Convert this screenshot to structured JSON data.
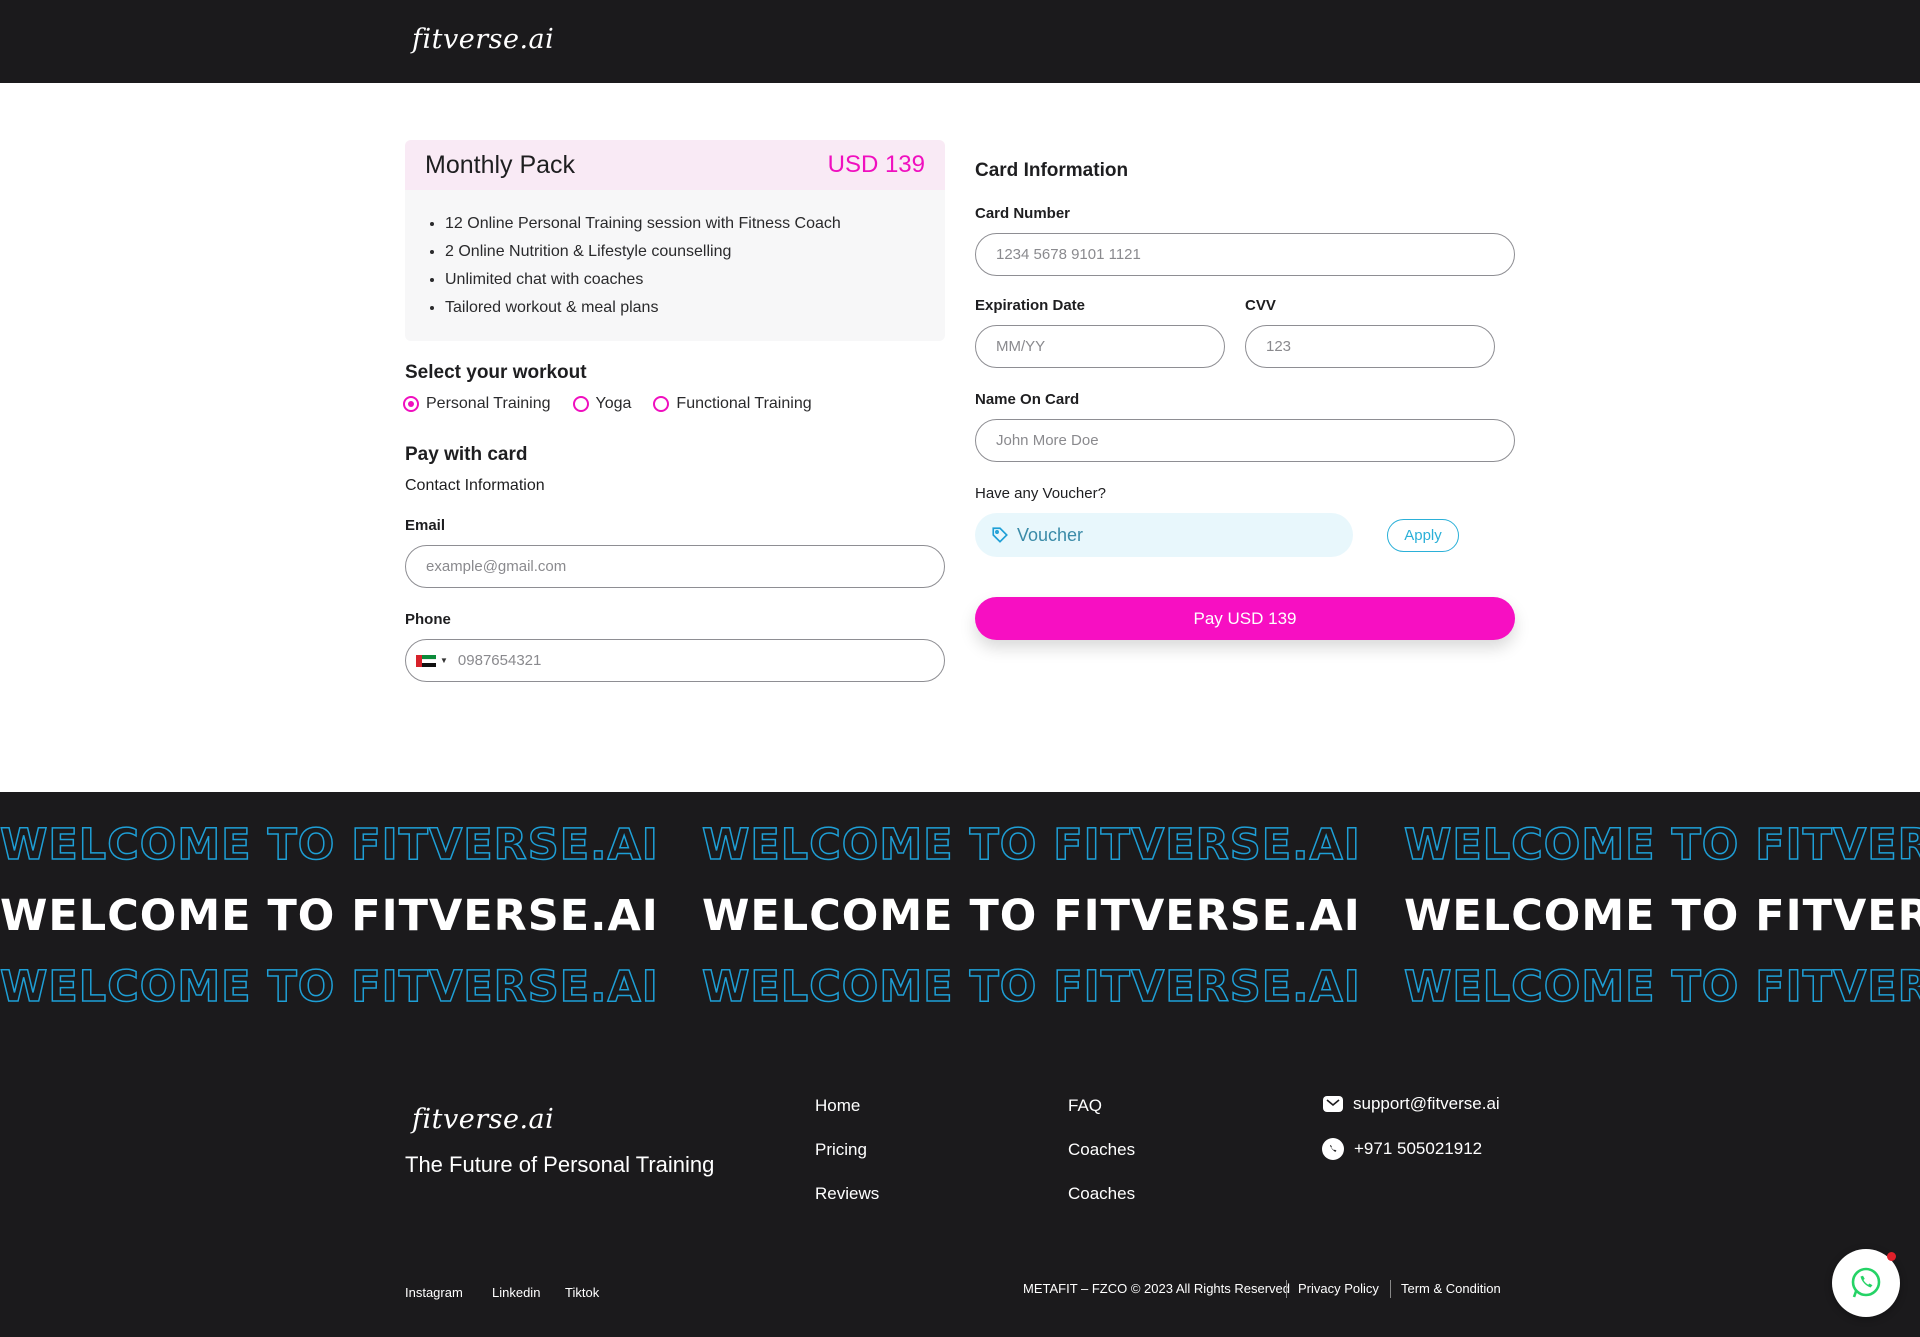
{
  "brand": {
    "logo_text": "fitverse.ai"
  },
  "pack": {
    "title": "Monthly Pack",
    "price": "USD 139",
    "features": [
      "12 Online Personal Training session with Fitness Coach",
      "2 Online Nutrition & Lifestyle counselling",
      "Unlimited chat with coaches",
      "Tailored workout & meal plans"
    ]
  },
  "workout": {
    "title": "Select your workout",
    "options": [
      "Personal Training",
      "Yoga",
      "Functional Training"
    ],
    "selected": "Personal Training"
  },
  "pay_with_card": {
    "title": "Pay with card",
    "subtitle": "Contact Information",
    "email_label": "Email",
    "email_placeholder": "example@gmail.com",
    "phone_label": "Phone",
    "phone_placeholder": "0987654321"
  },
  "card_info": {
    "title": "Card Information",
    "card_number_label": "Card Number",
    "card_number_placeholder": "1234 5678 9101 1121",
    "expiry_label": "Expiration Date",
    "expiry_placeholder": "MM/YY",
    "cvv_label": "CVV",
    "cvv_placeholder": "123",
    "name_label": "Name On Card",
    "name_placeholder": "John More Doe",
    "voucher_label": "Have any Voucher?",
    "voucher_placeholder": "Voucher",
    "apply_label": "Apply",
    "pay_label": "Pay USD 139"
  },
  "marquee": {
    "text": "WELCOME TO FITVERSE.AI"
  },
  "footer": {
    "logo_text": "fitverse.ai",
    "tagline": "The Future of Personal Training",
    "links_col1": [
      "Home",
      "Pricing",
      "Reviews"
    ],
    "links_col2": [
      "FAQ",
      "Coaches",
      "Coaches"
    ],
    "email": "support@fitverse.ai",
    "phone": "+971 505021912",
    "social": [
      "Instagram",
      "Linkedin",
      "Tiktok"
    ],
    "copyright": "METAFIT – FZCO © 2023 All Rights Reserved",
    "privacy": "Privacy Policy",
    "terms": "Term & Condition"
  },
  "colors": {
    "accent": "#f70fc2",
    "outline": "#1e9fd6",
    "dark": "#1b1a1c"
  },
  "icons": {
    "voucher": "tag-icon",
    "email": "mail-icon",
    "phone": "whatsapp-icon",
    "fab": "whatsapp-icon"
  }
}
